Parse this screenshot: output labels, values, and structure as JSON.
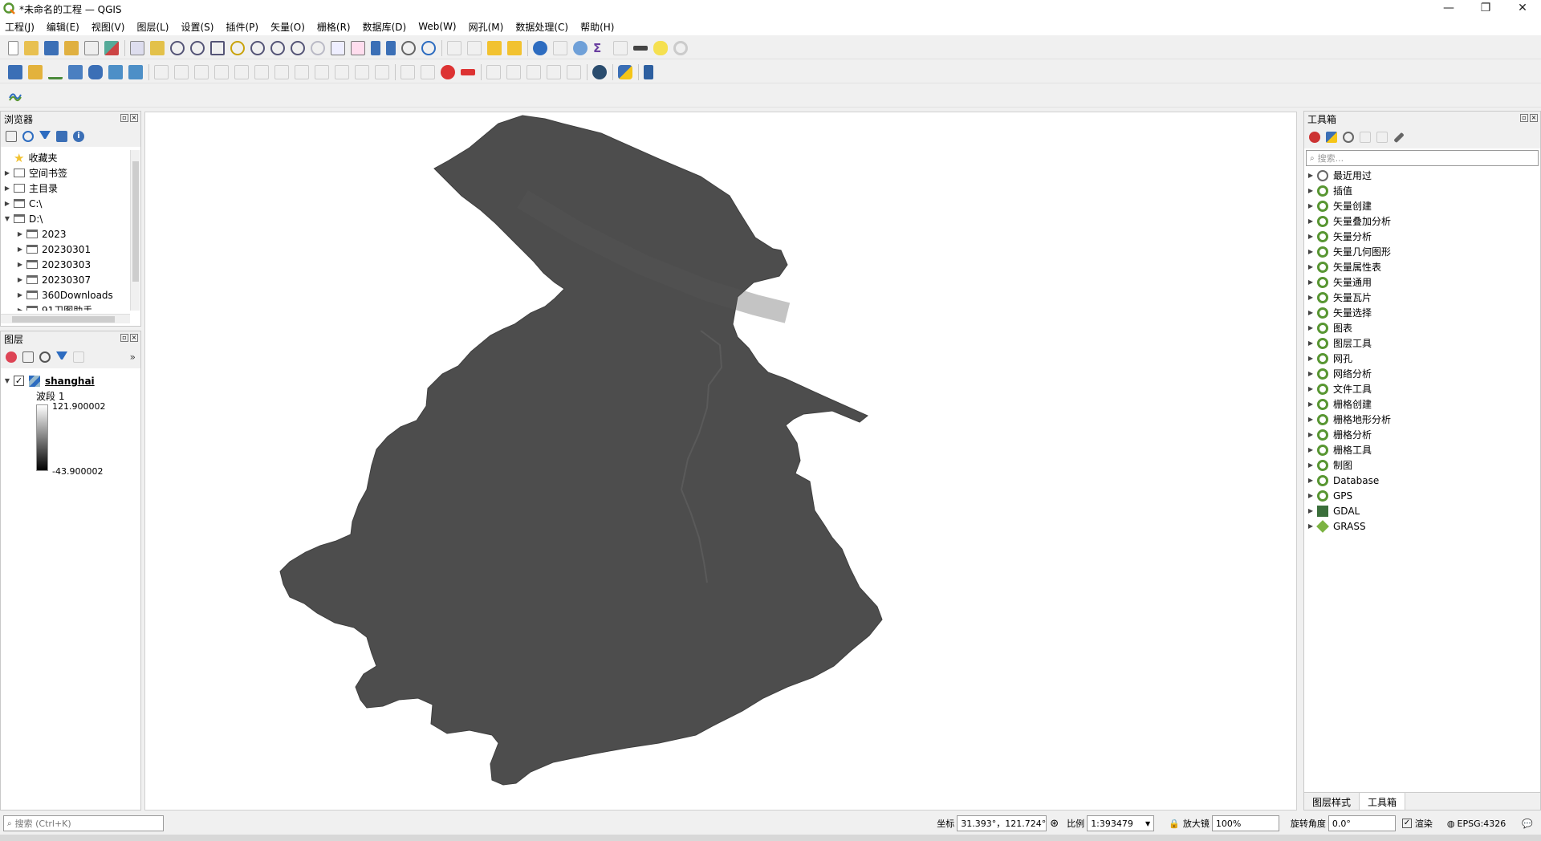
{
  "window": {
    "title": "*未命名的工程 — QGIS",
    "controls": [
      "—",
      "❐",
      "✕"
    ]
  },
  "menus": [
    "工程(J)",
    "编辑(E)",
    "视图(V)",
    "图层(L)",
    "设置(S)",
    "插件(P)",
    "矢量(O)",
    "栅格(R)",
    "数据库(D)",
    "Web(W)",
    "网孔(M)",
    "数据处理(C)",
    "帮助(H)"
  ],
  "browser": {
    "title": "浏览器",
    "items": [
      {
        "label": "收藏夹",
        "icon": "star-icon",
        "indent": 0,
        "expandable": false
      },
      {
        "label": "空间书签",
        "icon": "bookmark-icon",
        "indent": 0,
        "expandable": true
      },
      {
        "label": "主目录",
        "icon": "home-icon",
        "indent": 0,
        "expandable": true
      },
      {
        "label": "C:\\",
        "icon": "folder-icon",
        "indent": 0,
        "expandable": true
      },
      {
        "label": "D:\\",
        "icon": "folder-icon",
        "indent": 0,
        "expandable": true,
        "expanded": true
      },
      {
        "label": "2023",
        "icon": "folder-icon",
        "indent": 1,
        "expandable": true
      },
      {
        "label": "20230301",
        "icon": "folder-icon",
        "indent": 1,
        "expandable": true
      },
      {
        "label": "20230303",
        "icon": "folder-icon",
        "indent": 1,
        "expandable": true
      },
      {
        "label": "20230307",
        "icon": "folder-icon",
        "indent": 1,
        "expandable": true
      },
      {
        "label": "360Downloads",
        "icon": "folder-icon",
        "indent": 1,
        "expandable": true
      },
      {
        "label": "91卫图助手",
        "icon": "folder-icon",
        "indent": 1,
        "expandable": true
      }
    ]
  },
  "layers": {
    "title": "图层",
    "layer_name": "shanghai",
    "band_label": "波段 1",
    "max_value": "121.900002",
    "min_value": "-43.900002",
    "checked": true
  },
  "toolbox": {
    "title": "工具箱",
    "search_placeholder": "搜索...",
    "items": [
      {
        "label": "最近用过",
        "icon": "clock-icon"
      },
      {
        "label": "插值",
        "icon": "qgis-icon"
      },
      {
        "label": "矢量创建",
        "icon": "qgis-icon"
      },
      {
        "label": "矢量叠加分析",
        "icon": "qgis-icon"
      },
      {
        "label": "矢量分析",
        "icon": "qgis-icon"
      },
      {
        "label": "矢量几何图形",
        "icon": "qgis-icon"
      },
      {
        "label": "矢量属性表",
        "icon": "qgis-icon"
      },
      {
        "label": "矢量通用",
        "icon": "qgis-icon"
      },
      {
        "label": "矢量瓦片",
        "icon": "qgis-icon"
      },
      {
        "label": "矢量选择",
        "icon": "qgis-icon"
      },
      {
        "label": "图表",
        "icon": "qgis-icon"
      },
      {
        "label": "图层工具",
        "icon": "qgis-icon"
      },
      {
        "label": "网孔",
        "icon": "qgis-icon"
      },
      {
        "label": "网络分析",
        "icon": "qgis-icon"
      },
      {
        "label": "文件工具",
        "icon": "qgis-icon"
      },
      {
        "label": "栅格创建",
        "icon": "qgis-icon"
      },
      {
        "label": "栅格地形分析",
        "icon": "qgis-icon"
      },
      {
        "label": "栅格分析",
        "icon": "qgis-icon"
      },
      {
        "label": "栅格工具",
        "icon": "qgis-icon"
      },
      {
        "label": "制图",
        "icon": "qgis-icon"
      },
      {
        "label": "Database",
        "icon": "qgis-icon"
      },
      {
        "label": "GPS",
        "icon": "qgis-icon"
      },
      {
        "label": "GDAL",
        "icon": "gdal-icon"
      },
      {
        "label": "GRASS",
        "icon": "grass-icon"
      }
    ],
    "tabs": [
      "图层样式",
      "工具箱"
    ],
    "active_tab": "工具箱"
  },
  "statusbar": {
    "locator_placeholder": "搜索 (Ctrl+K)",
    "coord_label": "坐标",
    "coord_value": "31.393°，121.724°",
    "scale_label": "比例",
    "scale_value": "1:393479",
    "magnifier_label": "放大镜",
    "magnifier_value": "100%",
    "rotation_label": "旋转角度",
    "rotation_value": "0.0°",
    "render_label": "渲染",
    "crs_label": "EPSG:4326",
    "render_checked": true
  },
  "colors": {
    "raster_fill": "#4d4d4d",
    "raster_border": "#3f3f3f",
    "qgis_green": "#589632",
    "accent_blue": "#2d6cc0"
  }
}
